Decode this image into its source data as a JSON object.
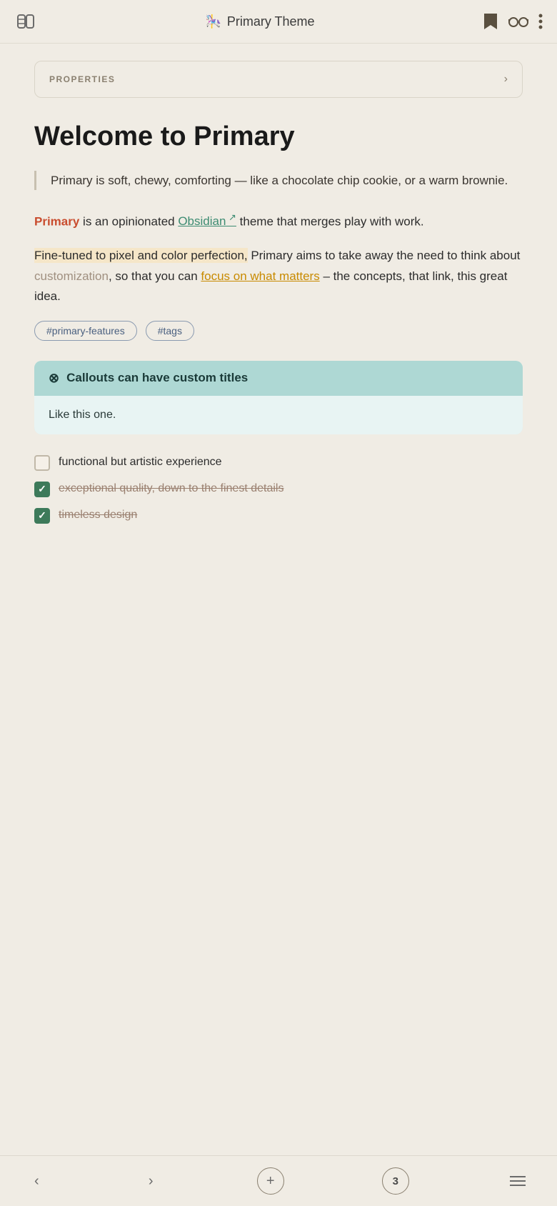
{
  "header": {
    "title": "Primary Theme",
    "emoji": "🎠",
    "bookmark_icon": "bookmark",
    "glasses_icon": "glasses",
    "more_icon": "more-vertical"
  },
  "properties": {
    "label": "PROPERTIES",
    "chevron": "›"
  },
  "main": {
    "title": "Welcome to Primary",
    "blockquote": "Primary is soft, chewy, comforting — like a chocolate chip cookie, or a warm brownie.",
    "paragraph1_pre": " is an opinionated ",
    "paragraph1_link": "Obsidian",
    "paragraph1_ext": "↗",
    "paragraph1_post": " theme that merges play with work.",
    "paragraph2_highlight": "Fine-tuned to pixel and color perfection,",
    "paragraph2_mid": " Primary aims to take away the need to think about ",
    "paragraph2_muted": "customization",
    "paragraph2_pre_link": ", so that you can ",
    "paragraph2_link": "focus on what matters",
    "paragraph2_post": " – the concepts, that link, this great idea.",
    "primary_label": "Primary"
  },
  "tags": [
    "#primary-features",
    "#tags"
  ],
  "callout": {
    "icon": "⊗",
    "title": "Callouts can have custom titles",
    "body": "Like this one."
  },
  "checklist": [
    {
      "text": "functional but artistic experience",
      "checked": false,
      "strikethrough": false
    },
    {
      "text": "exceptional quality, down to the finest details",
      "checked": true,
      "strikethrough": true
    },
    {
      "text": "timeless design",
      "checked": true,
      "strikethrough": true
    }
  ],
  "bottom_nav": {
    "back_label": "‹",
    "forward_label": "›",
    "add_label": "+",
    "page_number": "3",
    "menu_label": "menu"
  },
  "colors": {
    "primary_red": "#c94c2e",
    "teal_link": "#3d8c72",
    "yellow_link": "#c88a00",
    "muted_text": "#a09080",
    "highlight_bg": "#f5e6c8",
    "callout_header": "#aed8d4",
    "callout_body": "#e8f4f3",
    "checked_bg": "#3d7a5a"
  }
}
